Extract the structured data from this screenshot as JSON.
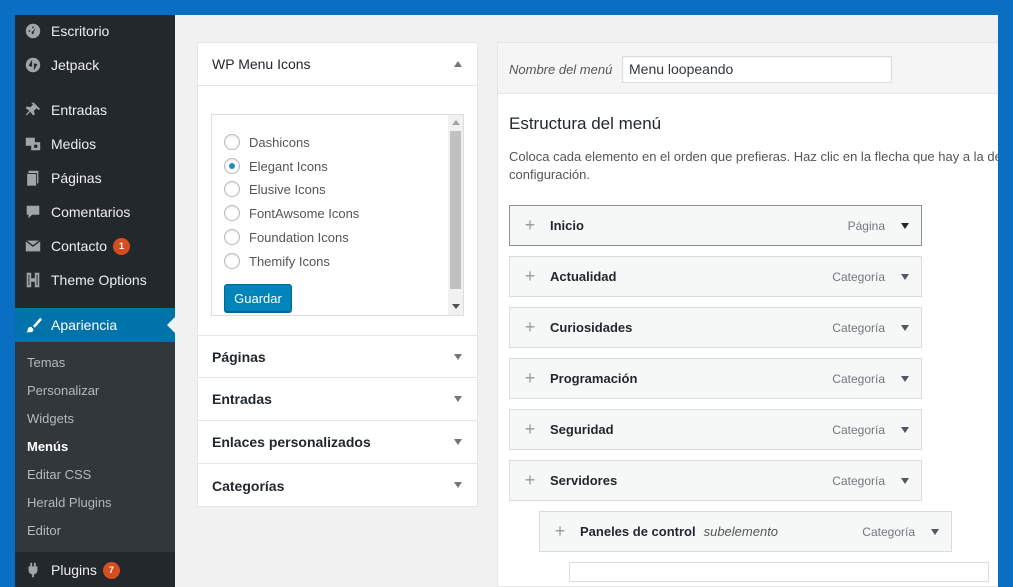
{
  "sidebar": {
    "items": [
      {
        "label": "Escritorio",
        "icon": "dashboard-icon"
      },
      {
        "label": "Jetpack",
        "icon": "jetpack-icon"
      },
      {
        "label": "Entradas",
        "icon": "pin-icon"
      },
      {
        "label": "Medios",
        "icon": "media-icon"
      },
      {
        "label": "Páginas",
        "icon": "pages-icon"
      },
      {
        "label": "Comentarios",
        "icon": "comment-icon"
      },
      {
        "label": "Contacto",
        "icon": "mail-icon",
        "badge": "1"
      },
      {
        "label": "Theme Options",
        "icon": "herald-icon"
      },
      {
        "label": "Apariencia",
        "icon": "brush-icon"
      },
      {
        "label": "Plugins",
        "icon": "plugin-icon",
        "badge": "7"
      }
    ],
    "submenu": [
      "Temas",
      "Personalizar",
      "Widgets",
      "Menús",
      "Editar CSS",
      "Herald Plugins",
      "Editor"
    ],
    "current_sub": "Menús"
  },
  "accordion": {
    "sections": [
      "WP Menu Icons",
      "Páginas",
      "Entradas",
      "Enlaces personalizados",
      "Categorías"
    ],
    "icon_sets": [
      "Dashicons",
      "Elegant Icons",
      "Elusive Icons",
      "FontAwsome Icons",
      "Foundation Icons",
      "Themify Icons"
    ],
    "selected": "Elegant Icons",
    "save_label": "Guardar"
  },
  "menu": {
    "name_label": "Nombre del menú",
    "name_value": "Menu loopeando",
    "structure_title": "Estructura del menú",
    "structure_desc_1": "Coloca cada elemento en el orden que prefieras. Haz clic en la flecha que hay a la derecha",
    "structure_desc_2": "configuración.",
    "items": [
      {
        "title": "Inicio",
        "type": "Página"
      },
      {
        "title": "Actualidad",
        "type": "Categoría"
      },
      {
        "title": "Curiosidades",
        "type": "Categoría"
      },
      {
        "title": "Programación",
        "type": "Categoría"
      },
      {
        "title": "Seguridad",
        "type": "Categoría"
      },
      {
        "title": "Servidores",
        "type": "Categoría"
      },
      {
        "title": "Paneles de control",
        "type": "Categoría",
        "sub": "subelemento"
      }
    ]
  },
  "colors": {
    "frame_border": "#0a6fc2",
    "sidebar": "#23282d",
    "active": "#0073aa",
    "button": "#0085ba"
  }
}
